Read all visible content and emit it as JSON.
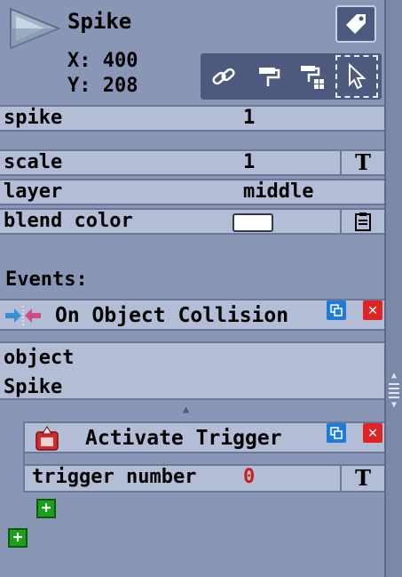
{
  "object": {
    "name": "Spike",
    "x_text": "X: 400",
    "y_text": "Y: 208"
  },
  "icons": {
    "object": "play-triangle-icon",
    "tag": "tag-icon",
    "link": "link-icon",
    "paint": "paint-roller-icon",
    "paint_grid": "paint-roller-grid-icon",
    "select": "cursor-select-icon",
    "text": "text-T-icon",
    "clipboard": "clipboard-icon",
    "collision": "collision-arrows-icon",
    "trigger": "trigger-icon",
    "copy": "copy-icon",
    "delete": "delete-icon",
    "add": "add-icon"
  },
  "properties": {
    "spike": {
      "label": "spike",
      "value": "1"
    },
    "scale": {
      "label": "scale",
      "value": "1",
      "button": "T"
    },
    "layer": {
      "label": "layer",
      "value": "middle"
    },
    "blend": {
      "label": "blend color",
      "value": "#ffffff"
    }
  },
  "events": {
    "title": "Events:",
    "collision": {
      "label": "On Object Collision",
      "param_label": "object",
      "param_value": "Spike",
      "action": {
        "label": "Activate Trigger",
        "param_label": "trigger number",
        "param_value": "0",
        "param_button": "T"
      }
    }
  },
  "colors": {
    "panel": "#8a96b5",
    "row": "#b3bdd6",
    "toolbar": "#4d5a7e",
    "copy": "#1e7bd8",
    "delete": "#e02424",
    "add": "#1aa01a",
    "trigger_value": "#c81e1e"
  }
}
